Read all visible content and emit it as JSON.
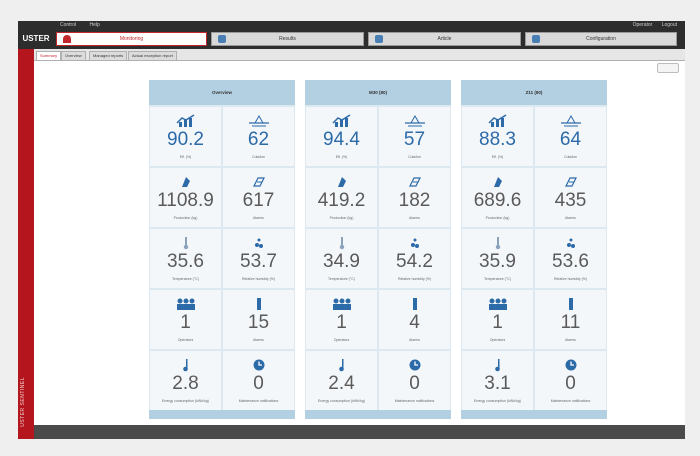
{
  "app": {
    "logo": "USTER",
    "menu": [
      "Control",
      "Help"
    ],
    "window_controls": [
      "Operator",
      "Logout"
    ],
    "side_label": "USTER SENTINEL"
  },
  "nav_tabs": [
    {
      "label": "Monitoring",
      "icon": "gauge-icon",
      "active": true
    },
    {
      "label": "Results",
      "icon": "results-icon",
      "active": false
    },
    {
      "label": "Article",
      "icon": "article-icon",
      "active": false
    },
    {
      "label": "Configuration",
      "icon": "gears-icon",
      "active": false
    }
  ],
  "sub_tabs": [
    {
      "label": "Summary",
      "active": true
    },
    {
      "label": "Overview",
      "active": false
    },
    {
      "label": "Managed reports",
      "active": false
    },
    {
      "label": "Actual exception report",
      "active": false
    }
  ],
  "colors": {
    "accent": "#b5161d",
    "value_blue": "#2c6aa8",
    "panel_header": "#b3d0e2"
  },
  "panels": [
    {
      "title": "Overview",
      "rows": [
        [
          {
            "icon": "efficiency-chart-icon",
            "value": "90.2",
            "label": "Eff. (%)",
            "color": "blue"
          },
          {
            "icon": "scale-icon",
            "value": "62",
            "label": "Cuts/km",
            "color": "blue"
          }
        ],
        [
          {
            "icon": "yarn-icon",
            "value": "1108.9",
            "label": "Production (kg)",
            "color": "grey"
          },
          {
            "icon": "package-icon",
            "value": "617",
            "label": "Alarms",
            "color": "grey"
          }
        ],
        [
          {
            "icon": "thermometer-icon",
            "value": "35.6",
            "label": "Temperature (°C)",
            "color": "grey"
          },
          {
            "icon": "humidity-icon",
            "value": "53.7",
            "label": "Relative humidity (%)",
            "color": "grey"
          }
        ],
        [
          {
            "icon": "people-icon",
            "value": "1",
            "label": "Operators",
            "color": "grey"
          },
          {
            "icon": "spindle-icon",
            "value": "15",
            "label": "Alarms",
            "color": "grey"
          }
        ],
        [
          {
            "icon": "flask-icon",
            "value": "2.8",
            "label": "Energy consumption (kWh/kg)",
            "color": "grey"
          },
          {
            "icon": "clock-icon",
            "value": "0",
            "label": "Maintenance notifications",
            "color": "grey"
          }
        ]
      ]
    },
    {
      "title": "M30 (80)",
      "rows": [
        [
          {
            "icon": "efficiency-chart-icon",
            "value": "94.4",
            "label": "Eff. (%)",
            "color": "blue"
          },
          {
            "icon": "scale-icon",
            "value": "57",
            "label": "Cuts/km",
            "color": "blue"
          }
        ],
        [
          {
            "icon": "yarn-icon",
            "value": "419.2",
            "label": "Production (kg)",
            "color": "grey"
          },
          {
            "icon": "package-icon",
            "value": "182",
            "label": "Alarms",
            "color": "grey"
          }
        ],
        [
          {
            "icon": "thermometer-icon",
            "value": "34.9",
            "label": "Temperature (°C)",
            "color": "grey"
          },
          {
            "icon": "humidity-icon",
            "value": "54.2",
            "label": "Relative humidity (%)",
            "color": "grey"
          }
        ],
        [
          {
            "icon": "people-icon",
            "value": "1",
            "label": "Operators",
            "color": "grey"
          },
          {
            "icon": "spindle-icon",
            "value": "4",
            "label": "Alarms",
            "color": "grey"
          }
        ],
        [
          {
            "icon": "flask-icon",
            "value": "2.4",
            "label": "Energy consumption (kWh/kg)",
            "color": "grey"
          },
          {
            "icon": "clock-icon",
            "value": "0",
            "label": "Maintenance notifications",
            "color": "grey"
          }
        ]
      ]
    },
    {
      "title": "Z11 (80)",
      "rows": [
        [
          {
            "icon": "efficiency-chart-icon",
            "value": "88.3",
            "label": "Eff. (%)",
            "color": "blue"
          },
          {
            "icon": "scale-icon",
            "value": "64",
            "label": "Cuts/km",
            "color": "blue"
          }
        ],
        [
          {
            "icon": "yarn-icon",
            "value": "689.6",
            "label": "Production (kg)",
            "color": "grey"
          },
          {
            "icon": "package-icon",
            "value": "435",
            "label": "Alarms",
            "color": "grey"
          }
        ],
        [
          {
            "icon": "thermometer-icon",
            "value": "35.9",
            "label": "Temperature (°C)",
            "color": "grey"
          },
          {
            "icon": "humidity-icon",
            "value": "53.6",
            "label": "Relative humidity (%)",
            "color": "grey"
          }
        ],
        [
          {
            "icon": "people-icon",
            "value": "1",
            "label": "Operators",
            "color": "grey"
          },
          {
            "icon": "spindle-icon",
            "value": "11",
            "label": "Alarms",
            "color": "grey"
          }
        ],
        [
          {
            "icon": "flask-icon",
            "value": "3.1",
            "label": "Energy consumption (kWh/kg)",
            "color": "grey"
          },
          {
            "icon": "clock-icon",
            "value": "0",
            "label": "Maintenance notifications",
            "color": "grey"
          }
        ]
      ]
    }
  ]
}
